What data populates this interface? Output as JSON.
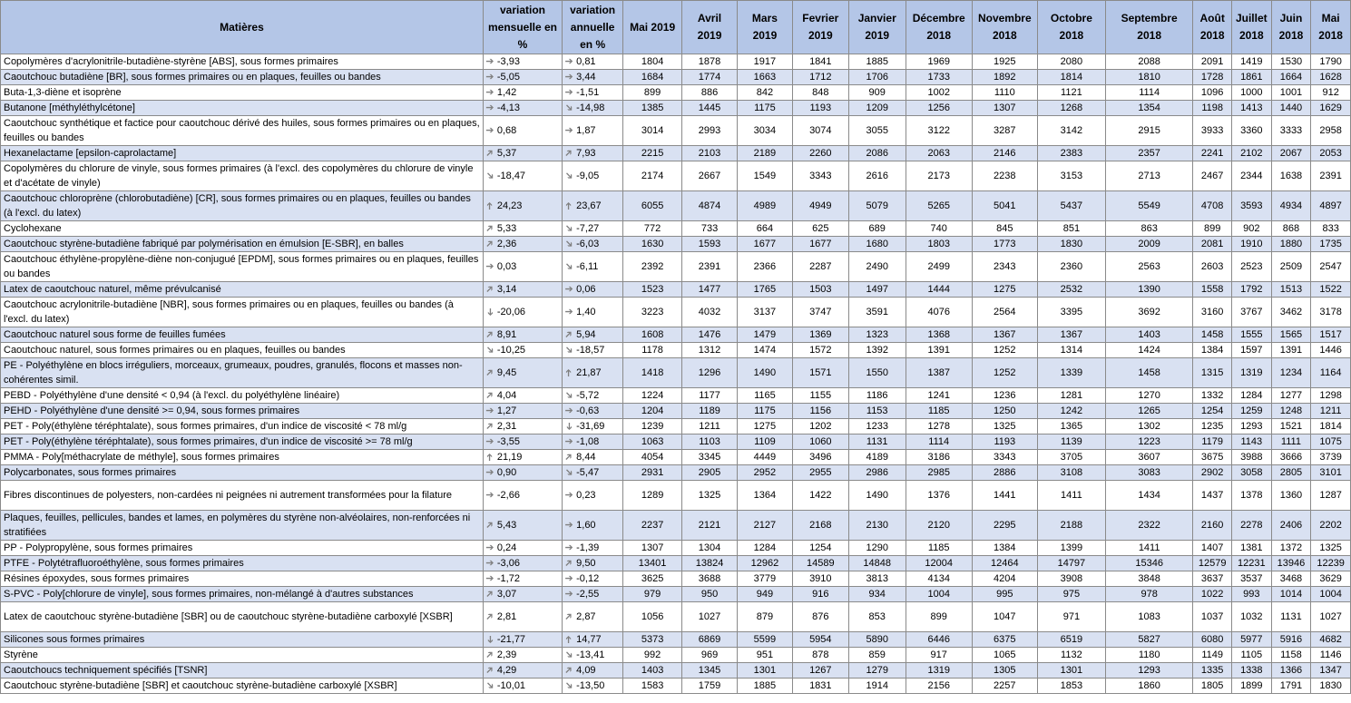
{
  "headers": {
    "matieres": "Matières",
    "var_mensuelle": "variation mensuelle en %",
    "var_annuelle": "variation annuelle en %",
    "months": [
      "Mai 2019",
      "Avril 2019",
      "Mars 2019",
      "Fevrier 2019",
      "Janvier 2019",
      "Décembre 2018",
      "Novembre 2018",
      "Octobre 2018",
      "Septembre 2018",
      "Août 2018",
      "Juillet 2018",
      "Juin 2018",
      "Mai 2018"
    ]
  },
  "arrow_icons": {
    "flat": "arrow-right-icon",
    "up": "arrow-up-right-icon",
    "down": "arrow-down-right-icon",
    "vup": "arrow-up-icon",
    "vdown": "arrow-down-icon"
  },
  "colors": {
    "header_bg": "#b4c6e7",
    "band_bg": "#d9e1f2",
    "arrow": "#7f7f7f"
  },
  "rows": [
    {
      "name": "Copolymères d'acrylonitrile-butadiène-styrène [ABS], sous formes primaires",
      "tall": false,
      "m": "-3,93",
      "m_dir": "flat",
      "a": "0,81",
      "a_dir": "flat",
      "values": [
        "1804",
        "1878",
        "1917",
        "1841",
        "1885",
        "1969",
        "1925",
        "2080",
        "2088",
        "2091",
        "1419",
        "1530",
        "1790"
      ]
    },
    {
      "name": "Caoutchouc butadiène [BR], sous formes primaires ou en plaques, feuilles ou bandes",
      "tall": false,
      "m": "-5,05",
      "m_dir": "flat",
      "a": "3,44",
      "a_dir": "flat",
      "values": [
        "1684",
        "1774",
        "1663",
        "1712",
        "1706",
        "1733",
        "1892",
        "1814",
        "1810",
        "1728",
        "1861",
        "1664",
        "1628"
      ]
    },
    {
      "name": "Buta-1,3-diène et isoprène",
      "tall": false,
      "m": "1,42",
      "m_dir": "flat",
      "a": "-1,51",
      "a_dir": "flat",
      "values": [
        "899",
        "886",
        "842",
        "848",
        "909",
        "1002",
        "1110",
        "1121",
        "1114",
        "1096",
        "1000",
        "1001",
        "912"
      ]
    },
    {
      "name": "Butanone [méthyléthylcétone]",
      "tall": false,
      "m": "-4,13",
      "m_dir": "flat",
      "a": "-14,98",
      "a_dir": "down",
      "values": [
        "1385",
        "1445",
        "1175",
        "1193",
        "1209",
        "1256",
        "1307",
        "1268",
        "1354",
        "1198",
        "1413",
        "1440",
        "1629"
      ]
    },
    {
      "name": "Caoutchouc synthétique et factice pour caoutchouc dérivé des huiles, sous formes primaires ou en plaques, feuilles ou bandes",
      "tall": true,
      "m": "0,68",
      "m_dir": "flat",
      "a": "1,87",
      "a_dir": "flat",
      "values": [
        "3014",
        "2993",
        "3034",
        "3074",
        "3055",
        "3122",
        "3287",
        "3142",
        "2915",
        "3933",
        "3360",
        "3333",
        "2958"
      ]
    },
    {
      "name": "Hexanelactame [epsilon-caprolactame]",
      "tall": false,
      "m": "5,37",
      "m_dir": "up",
      "a": "7,93",
      "a_dir": "up",
      "values": [
        "2215",
        "2103",
        "2189",
        "2260",
        "2086",
        "2063",
        "2146",
        "2383",
        "2357",
        "2241",
        "2102",
        "2067",
        "2053"
      ]
    },
    {
      "name": "Copolymères du chlorure de vinyle, sous formes primaires (à l'excl. des copolymères du chlorure de vinyle et d'acétate de vinyle)",
      "tall": true,
      "m": "-18,47",
      "m_dir": "down",
      "a": "-9,05",
      "a_dir": "down",
      "values": [
        "2174",
        "2667",
        "1549",
        "3343",
        "2616",
        "2173",
        "2238",
        "3153",
        "2713",
        "2467",
        "2344",
        "1638",
        "2391"
      ]
    },
    {
      "name": "Caoutchouc chloroprène (chlorobutadiène) [CR], sous formes primaires ou en plaques, feuilles ou bandes (à l'excl. du latex)",
      "tall": true,
      "m": "24,23",
      "m_dir": "vup",
      "a": "23,67",
      "a_dir": "vup",
      "values": [
        "6055",
        "4874",
        "4989",
        "4949",
        "5079",
        "5265",
        "5041",
        "5437",
        "5549",
        "4708",
        "3593",
        "4934",
        "4897"
      ]
    },
    {
      "name": "Cyclohexane",
      "tall": false,
      "m": "5,33",
      "m_dir": "up",
      "a": "-7,27",
      "a_dir": "down",
      "values": [
        "772",
        "733",
        "664",
        "625",
        "689",
        "740",
        "845",
        "851",
        "863",
        "899",
        "902",
        "868",
        "833"
      ]
    },
    {
      "name": "Caoutchouc styrène-butadiène fabriqué par polymérisation en émulsion [E-SBR], en balles",
      "tall": false,
      "m": "2,36",
      "m_dir": "up",
      "a": "-6,03",
      "a_dir": "down",
      "values": [
        "1630",
        "1593",
        "1677",
        "1677",
        "1680",
        "1803",
        "1773",
        "1830",
        "2009",
        "2081",
        "1910",
        "1880",
        "1735"
      ]
    },
    {
      "name": "Caoutchouc éthylène-propylène-diène non-conjugué [EPDM], sous formes primaires ou en plaques, feuilles ou bandes",
      "tall": true,
      "m": "0,03",
      "m_dir": "flat",
      "a": "-6,11",
      "a_dir": "down",
      "values": [
        "2392",
        "2391",
        "2366",
        "2287",
        "2490",
        "2499",
        "2343",
        "2360",
        "2563",
        "2603",
        "2523",
        "2509",
        "2547"
      ]
    },
    {
      "name": "Latex de caoutchouc naturel, même prévulcanisé",
      "tall": false,
      "m": "3,14",
      "m_dir": "up",
      "a": "0,06",
      "a_dir": "flat",
      "values": [
        "1523",
        "1477",
        "1765",
        "1503",
        "1497",
        "1444",
        "1275",
        "2532",
        "1390",
        "1558",
        "1792",
        "1513",
        "1522"
      ]
    },
    {
      "name": "Caoutchouc acrylonitrile-butadiène [NBR], sous formes primaires ou en plaques, feuilles ou bandes (à l'excl. du latex)",
      "tall": true,
      "m": "-20,06",
      "m_dir": "vdown",
      "a": "1,40",
      "a_dir": "flat",
      "values": [
        "3223",
        "4032",
        "3137",
        "3747",
        "3591",
        "4076",
        "2564",
        "3395",
        "3692",
        "3160",
        "3767",
        "3462",
        "3178"
      ]
    },
    {
      "name": "Caoutchouc naturel sous forme de feuilles fumées",
      "tall": false,
      "m": "8,91",
      "m_dir": "up",
      "a": "5,94",
      "a_dir": "up",
      "values": [
        "1608",
        "1476",
        "1479",
        "1369",
        "1323",
        "1368",
        "1367",
        "1367",
        "1403",
        "1458",
        "1555",
        "1565",
        "1517"
      ]
    },
    {
      "name": "Caoutchouc naturel, sous formes primaires ou en plaques, feuilles ou bandes",
      "tall": false,
      "m": "-10,25",
      "m_dir": "down",
      "a": "-18,57",
      "a_dir": "down",
      "values": [
        "1178",
        "1312",
        "1474",
        "1572",
        "1392",
        "1391",
        "1252",
        "1314",
        "1424",
        "1384",
        "1597",
        "1391",
        "1446"
      ]
    },
    {
      "name": "PE - Polyéthylène en blocs irréguliers, morceaux, grumeaux, poudres, granulés, flocons et masses non-cohérentes simil.",
      "tall": true,
      "m": "9,45",
      "m_dir": "up",
      "a": "21,87",
      "a_dir": "vup",
      "values": [
        "1418",
        "1296",
        "1490",
        "1571",
        "1550",
        "1387",
        "1252",
        "1339",
        "1458",
        "1315",
        "1319",
        "1234",
        "1164"
      ]
    },
    {
      "name": "PEBD - Polyéthylène d'une densité < 0,94 (à l'excl. du polyéthylène linéaire)",
      "tall": false,
      "m": "4,04",
      "m_dir": "up",
      "a": "-5,72",
      "a_dir": "down",
      "values": [
        "1224",
        "1177",
        "1165",
        "1155",
        "1186",
        "1241",
        "1236",
        "1281",
        "1270",
        "1332",
        "1284",
        "1277",
        "1298"
      ]
    },
    {
      "name": "PEHD - Polyéthylène d'une densité >= 0,94, sous formes primaires",
      "tall": false,
      "m": "1,27",
      "m_dir": "flat",
      "a": "-0,63",
      "a_dir": "flat",
      "values": [
        "1204",
        "1189",
        "1175",
        "1156",
        "1153",
        "1185",
        "1250",
        "1242",
        "1265",
        "1254",
        "1259",
        "1248",
        "1211"
      ]
    },
    {
      "name": "PET - Poly(éthylène téréphtalate), sous formes primaires, d'un indice de viscosité < 78 ml/g",
      "tall": false,
      "m": "2,31",
      "m_dir": "up",
      "a": "-31,69",
      "a_dir": "vdown",
      "values": [
        "1239",
        "1211",
        "1275",
        "1202",
        "1233",
        "1278",
        "1325",
        "1365",
        "1302",
        "1235",
        "1293",
        "1521",
        "1814"
      ]
    },
    {
      "name": "PET - Poly(éthylène téréphtalate), sous formes primaires, d'un indice de viscosité >= 78 ml/g",
      "tall": false,
      "m": "-3,55",
      "m_dir": "flat",
      "a": "-1,08",
      "a_dir": "flat",
      "values": [
        "1063",
        "1103",
        "1109",
        "1060",
        "1131",
        "1114",
        "1193",
        "1139",
        "1223",
        "1179",
        "1143",
        "1111",
        "1075"
      ]
    },
    {
      "name": "PMMA - Poly[méthacrylate de méthyle], sous formes primaires",
      "tall": false,
      "m": "21,19",
      "m_dir": "vup",
      "a": "8,44",
      "a_dir": "up",
      "values": [
        "4054",
        "3345",
        "4449",
        "3496",
        "4189",
        "3186",
        "3343",
        "3705",
        "3607",
        "3675",
        "3988",
        "3666",
        "3739"
      ]
    },
    {
      "name": "Polycarbonates, sous formes primaires",
      "tall": false,
      "m": "0,90",
      "m_dir": "flat",
      "a": "-5,47",
      "a_dir": "down",
      "values": [
        "2931",
        "2905",
        "2952",
        "2955",
        "2986",
        "2985",
        "2886",
        "3108",
        "3083",
        "2902",
        "3058",
        "2805",
        "3101"
      ]
    },
    {
      "name": "Fibres discontinues de polyesters, non-cardées ni peignées ni autrement transformées pour la filature",
      "tall": true,
      "m": "-2,66",
      "m_dir": "flat",
      "a": "0,23",
      "a_dir": "flat",
      "values": [
        "1289",
        "1325",
        "1364",
        "1422",
        "1490",
        "1376",
        "1441",
        "1411",
        "1434",
        "1437",
        "1378",
        "1360",
        "1287"
      ]
    },
    {
      "name": "Plaques, feuilles, pellicules, bandes et lames, en polymères du styrène non-alvéolaires, non-renforcées ni stratifiées",
      "tall": true,
      "m": "5,43",
      "m_dir": "up",
      "a": "1,60",
      "a_dir": "flat",
      "values": [
        "2237",
        "2121",
        "2127",
        "2168",
        "2130",
        "2120",
        "2295",
        "2188",
        "2322",
        "2160",
        "2278",
        "2406",
        "2202"
      ]
    },
    {
      "name": "PP - Polypropylène, sous formes primaires",
      "tall": false,
      "m": "0,24",
      "m_dir": "flat",
      "a": "-1,39",
      "a_dir": "flat",
      "values": [
        "1307",
        "1304",
        "1284",
        "1254",
        "1290",
        "1185",
        "1384",
        "1399",
        "1411",
        "1407",
        "1381",
        "1372",
        "1325"
      ]
    },
    {
      "name": "PTFE - Polytétrafluoroéthylène, sous formes primaires",
      "tall": false,
      "m": "-3,06",
      "m_dir": "flat",
      "a": "9,50",
      "a_dir": "up",
      "values": [
        "13401",
        "13824",
        "12962",
        "14589",
        "14848",
        "12004",
        "12464",
        "14797",
        "15346",
        "12579",
        "12231",
        "13946",
        "12239"
      ]
    },
    {
      "name": "Résines époxydes, sous formes primaires",
      "tall": false,
      "m": "-1,72",
      "m_dir": "flat",
      "a": "-0,12",
      "a_dir": "flat",
      "values": [
        "3625",
        "3688",
        "3779",
        "3910",
        "3813",
        "4134",
        "4204",
        "3908",
        "3848",
        "3637",
        "3537",
        "3468",
        "3629"
      ]
    },
    {
      "name": "S-PVC - Poly[chlorure de vinyle], sous formes primaires, non-mélangé à d'autres substances",
      "tall": false,
      "m": "3,07",
      "m_dir": "up",
      "a": "-2,55",
      "a_dir": "flat",
      "values": [
        "979",
        "950",
        "949",
        "916",
        "934",
        "1004",
        "995",
        "975",
        "978",
        "1022",
        "993",
        "1014",
        "1004"
      ]
    },
    {
      "name": "Latex de caoutchouc styrène-butadiène [SBR] ou de caoutchouc styrène-butadiène carboxylé [XSBR]",
      "tall": true,
      "m": "2,81",
      "m_dir": "up",
      "a": "2,87",
      "a_dir": "up",
      "values": [
        "1056",
        "1027",
        "879",
        "876",
        "853",
        "899",
        "1047",
        "971",
        "1083",
        "1037",
        "1032",
        "1131",
        "1027"
      ]
    },
    {
      "name": "Silicones sous formes primaires",
      "tall": false,
      "m": "-21,77",
      "m_dir": "vdown",
      "a": "14,77",
      "a_dir": "vup",
      "values": [
        "5373",
        "6869",
        "5599",
        "5954",
        "5890",
        "6446",
        "6375",
        "6519",
        "5827",
        "6080",
        "5977",
        "5916",
        "4682"
      ]
    },
    {
      "name": "Styrène",
      "tall": false,
      "m": "2,39",
      "m_dir": "up",
      "a": "-13,41",
      "a_dir": "down",
      "values": [
        "992",
        "969",
        "951",
        "878",
        "859",
        "917",
        "1065",
        "1132",
        "1180",
        "1149",
        "1105",
        "1158",
        "1146"
      ]
    },
    {
      "name": "Caoutchoucs techniquement spécifiés [TSNR]",
      "tall": false,
      "m": "4,29",
      "m_dir": "up",
      "a": "4,09",
      "a_dir": "up",
      "values": [
        "1403",
        "1345",
        "1301",
        "1267",
        "1279",
        "1319",
        "1305",
        "1301",
        "1293",
        "1335",
        "1338",
        "1366",
        "1347"
      ]
    },
    {
      "name": "Caoutchouc styrène-butadiène [SBR] et caoutchouc styrène-butadiène carboxylé [XSBR]",
      "tall": false,
      "m": "-10,01",
      "m_dir": "down",
      "a": "-13,50",
      "a_dir": "down",
      "values": [
        "1583",
        "1759",
        "1885",
        "1831",
        "1914",
        "2156",
        "2257",
        "1853",
        "1860",
        "1805",
        "1899",
        "1791",
        "1830"
      ]
    }
  ]
}
